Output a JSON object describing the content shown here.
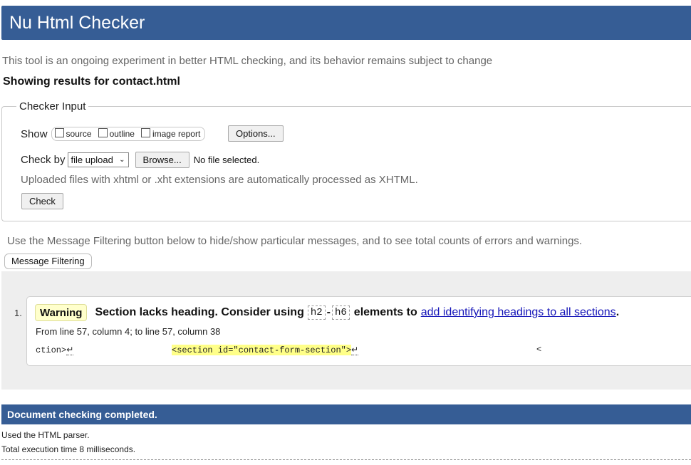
{
  "header": {
    "title": "Nu Html Checker"
  },
  "intro": "This tool is an ongoing experiment in better HTML checking, and its behavior remains subject to change",
  "results_title": "Showing results for contact.html",
  "checker_input": {
    "legend": "Checker Input",
    "show_label": "Show",
    "show_options": [
      {
        "label": "source",
        "checked": false
      },
      {
        "label": "outline",
        "checked": false
      },
      {
        "label": "image report",
        "checked": false
      }
    ],
    "options_button": "Options...",
    "check_by_label": "Check by",
    "check_by_value": "file upload",
    "browse_button": "Browse...",
    "file_status": "No file selected.",
    "xhtml_note": "Uploaded files with xhtml or .xht extensions are automatically processed as XHTML.",
    "check_button": "Check"
  },
  "filter_note": "Use the Message Filtering button below to hide/show particular messages, and to see total counts of errors and warnings.",
  "filter_button": "Message Filtering",
  "messages": [
    {
      "number": "1.",
      "type": "Warning",
      "text_before": "Section lacks heading. Consider using",
      "code_start": "h2",
      "code_sep": "-",
      "code_end": "h6",
      "text_after": "elements to",
      "link_text": "add identifying headings to all sections",
      "text_end": ".",
      "location": "From line 57, column 4; to line 57, column 38",
      "extract": {
        "pre": "ction>",
        "highlight": "<section id=\"contact-form-section\">",
        "post": "",
        "trail": "<"
      }
    }
  ],
  "completion": {
    "title": "Document checking completed.",
    "parser": "Used the HTML parser.",
    "execution": "Total execution time 8 milliseconds."
  },
  "colors": {
    "header_bg": "#365d95",
    "warning_bg": "#ffffcc",
    "highlight_bg": "#ffff88",
    "link": "#1515b8"
  }
}
